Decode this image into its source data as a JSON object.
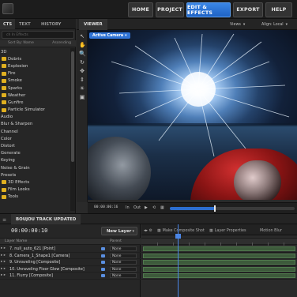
{
  "menu": {
    "items": [
      {
        "label": "HOME",
        "active": false
      },
      {
        "label": "PROJECT",
        "active": false
      },
      {
        "label": "EDIT & EFFECTS",
        "active": true
      },
      {
        "label": "EXPORT",
        "active": false
      },
      {
        "label": "HELP",
        "active": false
      }
    ]
  },
  "left_panel": {
    "tabs": [
      "CTS",
      "TEXT",
      "HISTORY"
    ],
    "active_tab": "CTS",
    "search_placeholder": "ch In Effects",
    "sort_label": "Sort By: Name",
    "sort_value": "Ascending",
    "items": [
      {
        "label": "3D",
        "type": "folder-open"
      },
      {
        "label": "Debris",
        "type": "folder"
      },
      {
        "label": "Explosion",
        "type": "folder"
      },
      {
        "label": "Fire",
        "type": "folder"
      },
      {
        "label": "Smoke",
        "type": "folder"
      },
      {
        "label": "Sparks",
        "type": "folder"
      },
      {
        "label": "Weather",
        "type": "folder"
      },
      {
        "label": "Gunfire",
        "type": "folder"
      },
      {
        "label": "Particle Simulator",
        "type": "folder"
      },
      {
        "label": "Audio",
        "type": "category"
      },
      {
        "label": "Blur & Sharpen",
        "type": "category"
      },
      {
        "label": "Channel",
        "type": "category"
      },
      {
        "label": "Color",
        "type": "category"
      },
      {
        "label": "Distort",
        "type": "category"
      },
      {
        "label": "Generate",
        "type": "category"
      },
      {
        "label": "Keying",
        "type": "category"
      },
      {
        "label": "Noise & Grain",
        "type": "category"
      },
      {
        "label": "Presets",
        "type": "category"
      },
      {
        "label": "3D Effects",
        "type": "folder"
      },
      {
        "label": "Film Looks",
        "type": "folder"
      },
      {
        "label": "Tools",
        "type": "folder"
      }
    ],
    "accent_color": "#e0b020"
  },
  "viewer": {
    "title": "VIEWER",
    "views_label": "Views",
    "align_label": "Align: Local",
    "camera_button": "Active Camera",
    "timecode": "00:00:00:16",
    "in_label": "In",
    "out_label": "Out"
  },
  "timeline": {
    "panel_title": "BOUJOU TRACK UPDATED",
    "current_time": "00:00:00:10",
    "new_layer_label": "New Layer",
    "columns": {
      "layer_name": "Layer Name",
      "parent": "Parent"
    },
    "tabs": [
      "Make Composite Shot",
      "Layer Properties",
      "Motion Blur"
    ],
    "layers": [
      {
        "name": "7. null_auto_621 [Point]",
        "parent": "None"
      },
      {
        "name": "8. Camera_1_Shape1 [Camera]",
        "parent": "None"
      },
      {
        "name": "9. Unraveling [Composite]",
        "parent": "None"
      },
      {
        "name": "10. Unraveling Floor Glow [Composite]",
        "parent": "None"
      },
      {
        "name": "11. Flurry [Composite]",
        "parent": "None"
      }
    ],
    "accent_color": "#4b86e6"
  }
}
